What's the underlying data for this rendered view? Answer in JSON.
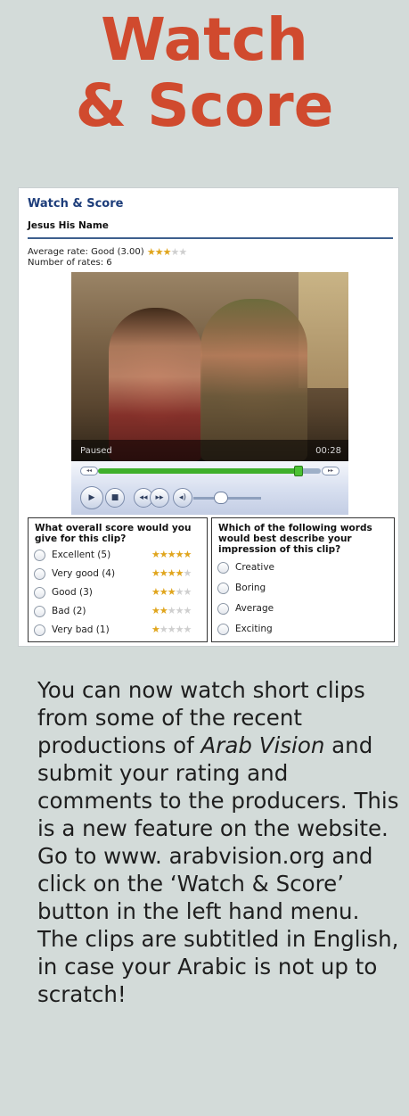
{
  "headline": {
    "line1": "Watch",
    "line2": "& Score"
  },
  "screenshot": {
    "title": "Watch & Score",
    "subtitle": "Jesus His Name",
    "average_rate": "Average rate: Good (3.00)",
    "average_stars": 3,
    "number_of_rates": "Number of rates: 6",
    "player": {
      "status": "Paused",
      "time": "00:28",
      "progress": 0.9
    },
    "score_panel": {
      "question": "What overall score would you give for this clip?",
      "options": [
        {
          "label": "Excellent (5)",
          "stars": 5
        },
        {
          "label": "Very good (4)",
          "stars": 4
        },
        {
          "label": "Good (3)",
          "stars": 3
        },
        {
          "label": "Bad (2)",
          "stars": 2
        },
        {
          "label": "Very bad (1)",
          "stars": 1
        }
      ]
    },
    "words_panel": {
      "question": "Which of the following words would best describe your impression of this clip?",
      "options": [
        "Creative",
        "Boring",
        "Average",
        "Exciting"
      ]
    }
  },
  "article": {
    "part1": "You can now watch short clips from some of the recent productions of ",
    "italic": "Arab Vision",
    "part2": " and submit your rating and comments to the producers. This is a new feature on the website.  Go to www. arabvision.org and click on the ‘Watch & Score’ button in the left hand menu.  The clips are subtitled in English, in case your Arabic is not up to scratch!"
  }
}
